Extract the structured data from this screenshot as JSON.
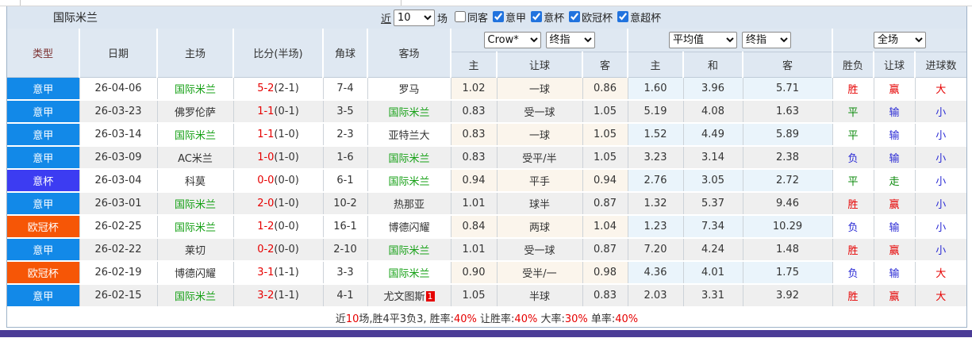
{
  "title": "国际米兰",
  "controls": {
    "near_label": "近",
    "unit_label": "场",
    "filters": [
      {
        "label": "同客",
        "checked": false
      },
      {
        "label": "意甲",
        "checked": true
      },
      {
        "label": "意杯",
        "checked": true
      },
      {
        "label": "欧冠杯",
        "checked": true
      },
      {
        "label": "意超杯",
        "checked": true
      }
    ]
  },
  "selects": {
    "count": "10",
    "book": "Crow*",
    "book_final": "终指",
    "avg": "平均值",
    "avg_final": "终指",
    "scope": "全场"
  },
  "table": {
    "headers": {
      "type": "类型",
      "date": "日期",
      "home": "主场",
      "score": "比分(半场)",
      "corner": "角球",
      "away": "客场",
      "sub": [
        "主",
        "让球",
        "客",
        "主",
        "和",
        "客",
        "胜负",
        "让球",
        "进球数"
      ]
    },
    "rows": [
      {
        "league": "意甲",
        "league_key": "serie_a",
        "date": "26-04-06",
        "home": "国际米兰",
        "score": "5-2",
        "half": "(2-1)",
        "corner": "7-4",
        "away": "罗马",
        "away_badge": "",
        "odds": [
          "1.02",
          "一球",
          "0.86"
        ],
        "avg": [
          "1.60",
          "3.96",
          "5.71"
        ],
        "results": [
          "胜",
          "赢",
          "大"
        ],
        "result_colors": [
          "red",
          "red",
          "red"
        ]
      },
      {
        "league": "意甲",
        "league_key": "serie_a",
        "date": "26-03-23",
        "home": "佛罗伦萨",
        "score": "1-1",
        "half": "(0-1)",
        "corner": "3-5",
        "away": "国际米兰",
        "away_badge": "",
        "odds": [
          "0.83",
          "受一球",
          "1.05"
        ],
        "avg": [
          "5.19",
          "4.08",
          "1.63"
        ],
        "results": [
          "平",
          "输",
          "小"
        ],
        "result_colors": [
          "green",
          "blue",
          "blue"
        ]
      },
      {
        "league": "意甲",
        "league_key": "serie_a",
        "date": "26-03-14",
        "home": "国际米兰",
        "score": "1-1",
        "half": "(1-0)",
        "corner": "2-3",
        "away": "亚特兰大",
        "away_badge": "",
        "odds": [
          "0.83",
          "一球",
          "1.05"
        ],
        "avg": [
          "1.52",
          "4.49",
          "5.89"
        ],
        "results": [
          "平",
          "输",
          "小"
        ],
        "result_colors": [
          "green",
          "blue",
          "blue"
        ]
      },
      {
        "league": "意甲",
        "league_key": "serie_a",
        "date": "26-03-09",
        "home": "AC米兰",
        "score": "1-0",
        "half": "(1-0)",
        "corner": "1-6",
        "away": "国际米兰",
        "away_badge": "",
        "odds": [
          "0.83",
          "受平/半",
          "1.05"
        ],
        "avg": [
          "3.23",
          "3.14",
          "2.38"
        ],
        "results": [
          "负",
          "输",
          "小"
        ],
        "result_colors": [
          "blue",
          "blue",
          "blue"
        ]
      },
      {
        "league": "意杯",
        "league_key": "coppa",
        "date": "26-03-04",
        "home": "科莫",
        "score": "0-0",
        "half": "(0-0)",
        "corner": "6-1",
        "away": "国际米兰",
        "away_badge": "",
        "odds": [
          "0.94",
          "平手",
          "0.94"
        ],
        "avg": [
          "2.76",
          "3.05",
          "2.72"
        ],
        "results": [
          "平",
          "走",
          "小"
        ],
        "result_colors": [
          "green",
          "green",
          "blue"
        ]
      },
      {
        "league": "意甲",
        "league_key": "serie_a",
        "date": "26-03-01",
        "home": "国际米兰",
        "score": "2-0",
        "half": "(1-0)",
        "corner": "10-2",
        "away": "热那亚",
        "away_badge": "",
        "odds": [
          "1.01",
          "球半",
          "0.87"
        ],
        "avg": [
          "1.32",
          "5.37",
          "9.46"
        ],
        "results": [
          "胜",
          "赢",
          "小"
        ],
        "result_colors": [
          "red",
          "red",
          "blue"
        ]
      },
      {
        "league": "欧冠杯",
        "league_key": "ucl",
        "date": "26-02-25",
        "home": "国际米兰",
        "score": "1-2",
        "half": "(0-0)",
        "corner": "16-1",
        "away": "博德闪耀",
        "away_badge": "",
        "odds": [
          "0.84",
          "两球",
          "1.04"
        ],
        "avg": [
          "1.23",
          "7.34",
          "10.29"
        ],
        "results": [
          "负",
          "输",
          "小"
        ],
        "result_colors": [
          "blue",
          "blue",
          "blue"
        ]
      },
      {
        "league": "意甲",
        "league_key": "serie_a",
        "date": "26-02-22",
        "home": "莱切",
        "score": "0-2",
        "half": "(0-0)",
        "corner": "2-10",
        "away": "国际米兰",
        "away_badge": "",
        "odds": [
          "1.01",
          "受一球",
          "0.87"
        ],
        "avg": [
          "7.20",
          "4.24",
          "1.48"
        ],
        "results": [
          "胜",
          "赢",
          "小"
        ],
        "result_colors": [
          "red",
          "red",
          "blue"
        ]
      },
      {
        "league": "欧冠杯",
        "league_key": "ucl",
        "date": "26-02-19",
        "home": "博德闪耀",
        "score": "3-1",
        "half": "(1-1)",
        "corner": "3-3",
        "away": "国际米兰",
        "away_badge": "",
        "odds": [
          "0.90",
          "受半/一",
          "0.98"
        ],
        "avg": [
          "4.36",
          "4.01",
          "1.75"
        ],
        "results": [
          "负",
          "输",
          "大"
        ],
        "result_colors": [
          "blue",
          "blue",
          "red"
        ]
      },
      {
        "league": "意甲",
        "league_key": "serie_a",
        "date": "26-02-15",
        "home": "国际米兰",
        "score": "3-2",
        "half": "(1-1)",
        "corner": "4-1",
        "away": "尤文图斯",
        "away_badge": "1",
        "odds": [
          "1.05",
          "半球",
          "0.83"
        ],
        "avg": [
          "2.03",
          "3.31",
          "3.92"
        ],
        "results": [
          "胜",
          "赢",
          "大"
        ],
        "result_colors": [
          "red",
          "red",
          "red"
        ]
      }
    ]
  },
  "footer": {
    "segments": [
      {
        "text": "近",
        "color": "dark"
      },
      {
        "text": "10",
        "color": "red"
      },
      {
        "text": "场,胜4平3负3, 胜率:",
        "color": "dark"
      },
      {
        "text": "40%",
        "color": "red"
      },
      {
        "text": " 让胜率:",
        "color": "dark"
      },
      {
        "text": "40%",
        "color": "red"
      },
      {
        "text": " 大率:",
        "color": "dark"
      },
      {
        "text": "30%",
        "color": "red"
      },
      {
        "text": " 单率:",
        "color": "dark"
      },
      {
        "text": "40%",
        "color": "red"
      }
    ]
  },
  "colors": {
    "serie_a": "#1289e8",
    "coppa": "#3c3cf2",
    "ucl": "#f65606",
    "self_team": "#15a015",
    "score_red": "#e60000",
    "purple_bar": "#4b3c96"
  }
}
